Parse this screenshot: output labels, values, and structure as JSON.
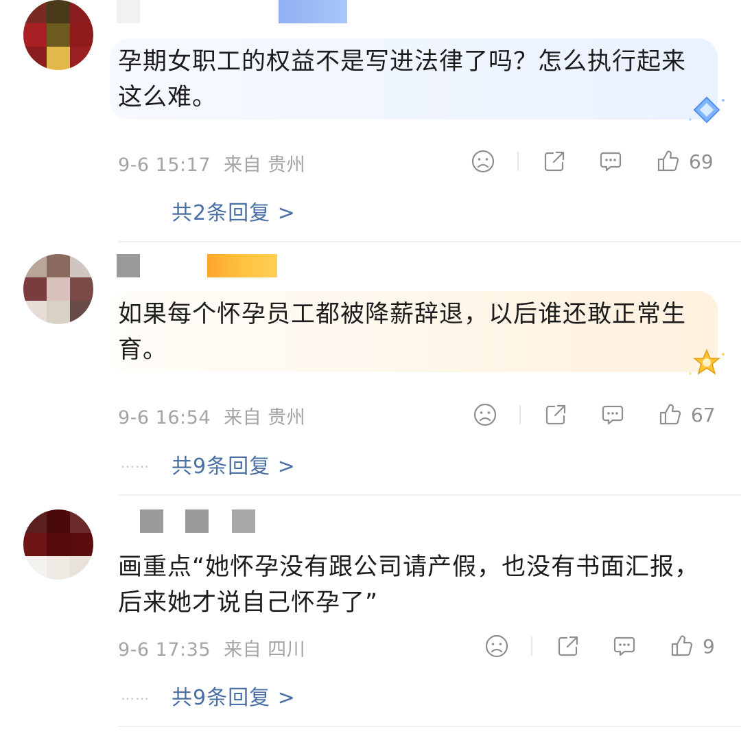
{
  "comments": [
    {
      "text_line1": "孕期女职工的权益不是写进法律了吗？怎么执行起来",
      "text_line2": "这么难。",
      "timestamp": "9-6 15:17",
      "location": "来自 贵州",
      "likes": "69",
      "replies": "共2条回复 >",
      "bubble_color": "#eef4ff",
      "badge": "diamond-badge"
    },
    {
      "text_line1": "如果每个怀孕员工都被降薪辞退，以后谁还敢正常生",
      "text_line2": "育。",
      "timestamp": "9-6 16:54",
      "location": "来自 贵州",
      "likes": "67",
      "replies": "共9条回复 >",
      "replies_prefix": "……",
      "bubble_color": "#fff6ea",
      "badge": "gold-star-badge"
    },
    {
      "text_line1": "画重点“她怀孕没有跟公司请产假，也没有书面汇报，",
      "text_line2": "后来她才说自己怀孕了”",
      "timestamp": "9-6 17:35",
      "location": "来自 四川",
      "likes": "9",
      "replies": "共9条回复 >",
      "replies_prefix": "……"
    }
  ],
  "icons": {
    "dislike": "sad-face-icon",
    "share": "share-icon",
    "comment": "comment-icon",
    "like": "thumbs-up-icon"
  },
  "colors": {
    "reply_link": "#4a6fa5",
    "meta": "#a4a4a4"
  }
}
